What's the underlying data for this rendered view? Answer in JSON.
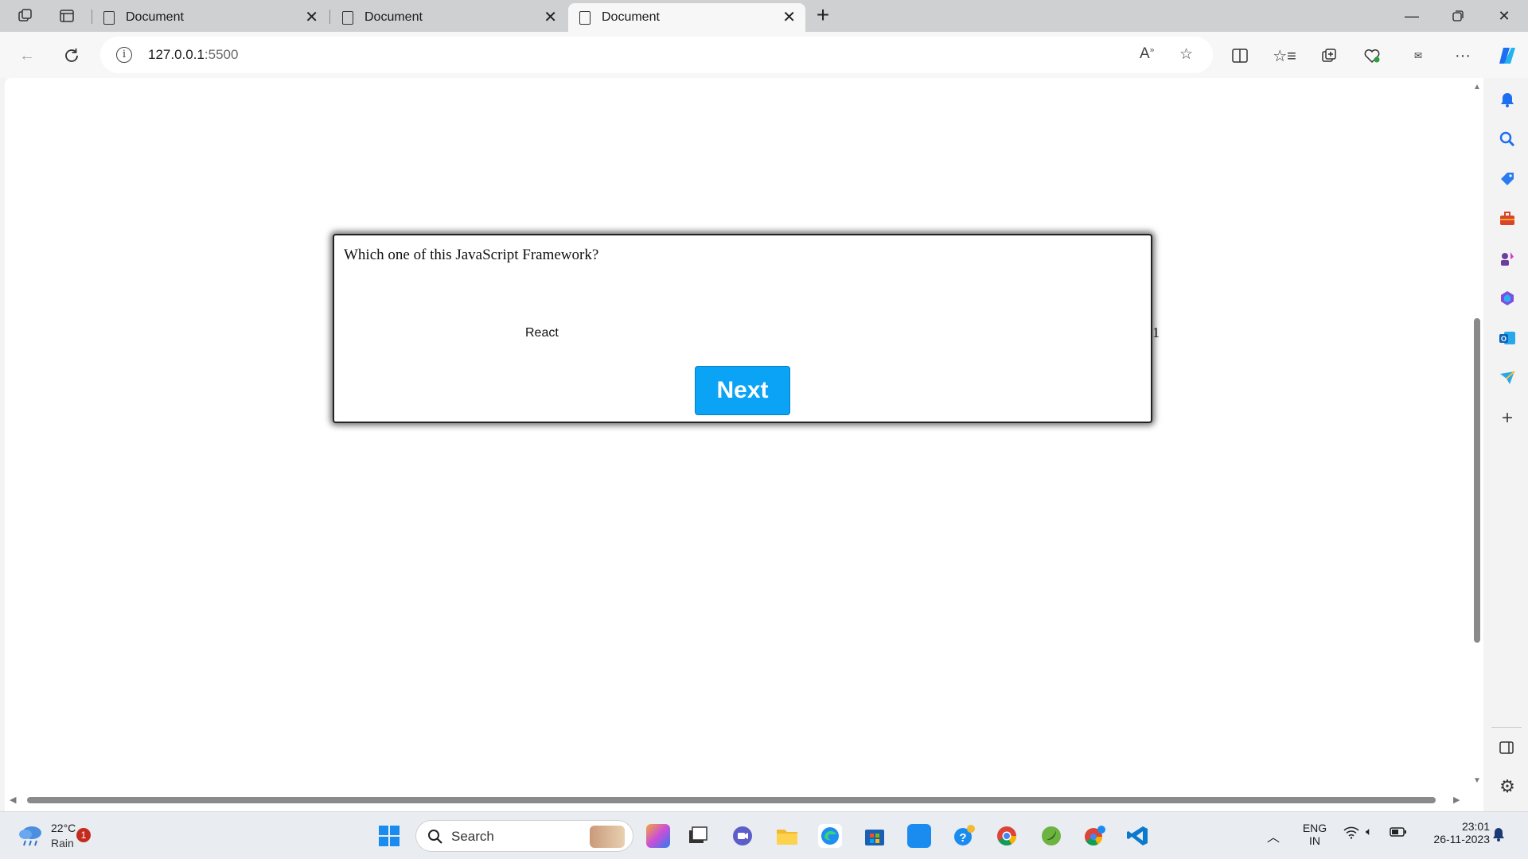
{
  "browser": {
    "tabs": [
      {
        "label": "Document"
      },
      {
        "label": "Document"
      },
      {
        "label": "Document"
      }
    ],
    "address": {
      "host": "127.0.0.1",
      "port": ":5500"
    }
  },
  "quiz": {
    "question": "Which one of this JavaScript Framework?",
    "option": "React",
    "overflow_char": "1",
    "next_label": "Next"
  },
  "taskbar": {
    "weather_temp": "22°C",
    "weather_desc": "Rain",
    "weather_badge": "1",
    "search_label": "Search",
    "lang_line1": "ENG",
    "lang_line2": "IN",
    "time": "23:01",
    "date": "26-11-2023"
  },
  "colors": {
    "next_button": "#0aa3f5",
    "tab_strip": "#cfd0d2"
  }
}
